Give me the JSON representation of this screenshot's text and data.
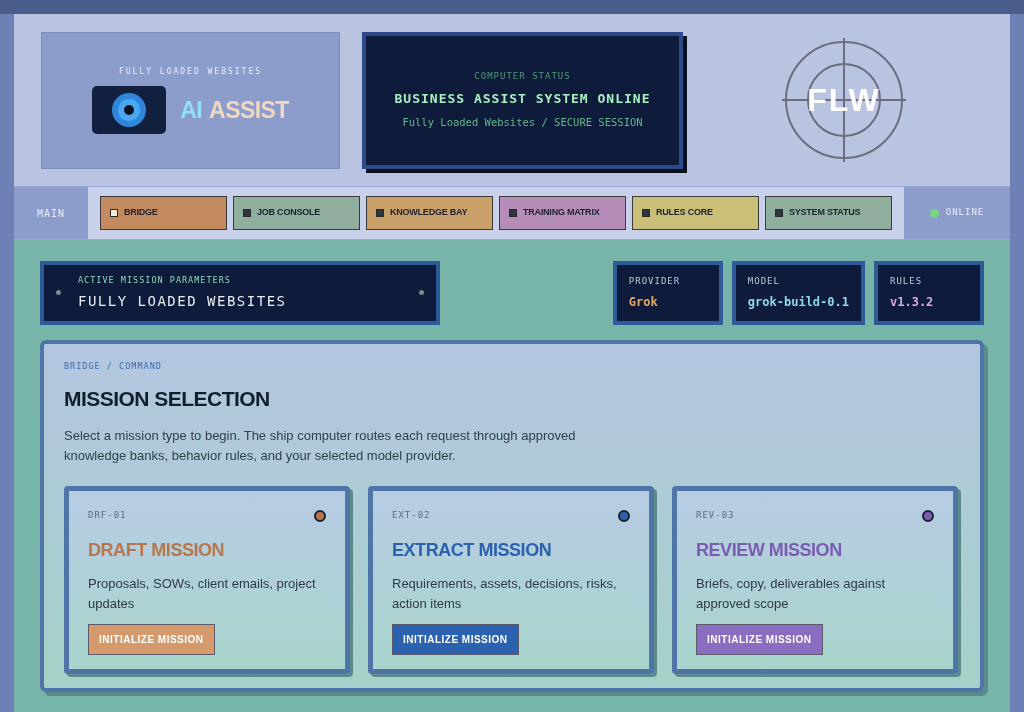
{
  "brand": {
    "caption": "FULLY LOADED WEBSITES",
    "title_part_1": "AI",
    "title_part_2": "ASSIST"
  },
  "status_panel": {
    "label": "COMPUTER STATUS",
    "headline": "BUSINESS ASSIST SYSTEM ONLINE",
    "subline": "Fully Loaded Websites / SECURE SESSION"
  },
  "logo": {
    "text": "FLW"
  },
  "nav": {
    "section": "MAIN",
    "items": [
      {
        "label": "BRIDGE",
        "selected": true,
        "color": "#c28a5e"
      },
      {
        "label": "JOB CONSOLE",
        "selected": false,
        "color": "#8fae9e"
      },
      {
        "label": "KNOWLEDGE BAY",
        "selected": false,
        "color": "#c9a06a"
      },
      {
        "label": "TRAINING MATRIX",
        "selected": false,
        "color": "#b68cb8"
      },
      {
        "label": "RULES CORE",
        "selected": false,
        "color": "#c9bf78"
      },
      {
        "label": "SYSTEM STATUS",
        "selected": false,
        "color": "#8fae9e"
      }
    ],
    "status": {
      "label": "ONLINE",
      "on": true
    }
  },
  "mission_parameters": {
    "label": "ACTIVE MISSION PARAMETERS",
    "value": "FULLY LOADED WEBSITES"
  },
  "settings": [
    {
      "label": "PROVIDER",
      "value": "Grok",
      "color": "#e8a86a"
    },
    {
      "label": "MODEL",
      "value": "grok-build-0.1",
      "color": "#8fd8f0"
    },
    {
      "label": "RULES",
      "value": "v1.3.2",
      "color": "#d8a8e8"
    }
  ],
  "main": {
    "breadcrumb": "BRIDGE / COMMAND",
    "title": "MISSION SELECTION",
    "description": "Select a mission type to begin. The ship computer routes each request through approved knowledge banks, behavior rules, and your selected model provider.",
    "missions": [
      {
        "code": "DRF-01",
        "title": "DRAFT MISSION",
        "description": "Proposals, SOWs, client emails, project updates",
        "button": "INITIALIZE MISSION",
        "color": "#b8764a"
      },
      {
        "code": "EXT-02",
        "title": "EXTRACT MISSION",
        "description": "Requirements, assets, decisions, risks, action items",
        "button": "INITIALIZE MISSION",
        "color": "#2a62b0"
      },
      {
        "code": "REV-03",
        "title": "REVIEW MISSION",
        "description": "Briefs, copy, deliverables against approved scope",
        "button": "INITIALIZE MISSION",
        "color": "#7a5cb0"
      }
    ]
  }
}
